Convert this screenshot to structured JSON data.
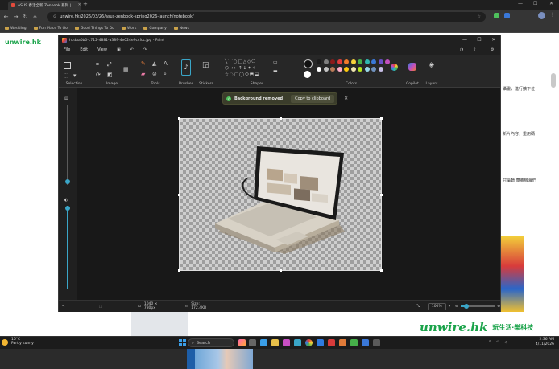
{
  "browser": {
    "tab_title": "ASUS 春活全新 Zenbook 系列 | ...",
    "url": "unwire.hk/2026/03/26/asus-zenbook-spring2026-launch/notebook/",
    "bookmarks": [
      "Wedding",
      "Fun Place To Go",
      "Good Things To Do",
      "Work",
      "Company",
      "News"
    ]
  },
  "site": {
    "logo_top": "unwire.hk",
    "side_texts": [
      "攝畫，進行擴下位",
      "新片內容，重用碼",
      "討論轉 華義機海們"
    ],
    "footer_logo": "unwire.hk",
    "footer_slogan": "玩生活‧樂科技"
  },
  "paint": {
    "window_title": "hcdaa0b0-c712-4881-a389-4e024e9ccfcc.jpg - Paint",
    "menu": [
      "File",
      "Edit",
      "View"
    ],
    "ribbon_groups": [
      "Selection",
      "Image",
      "Tools",
      "Brushes",
      "Stickers",
      "Shapes",
      "Colors",
      "Copilot",
      "Layers"
    ],
    "toast": {
      "message": "Background removed",
      "action": "Copy to clipboard"
    },
    "status": {
      "dimensions": "1040 × 780px",
      "size": "Size: 172.4KB",
      "zoom": "100%"
    },
    "colors": [
      "#1b1b1b",
      "#7f7f7f",
      "#8b1a1a",
      "#e03b3b",
      "#f27a2a",
      "#f6d13a",
      "#46b04a",
      "#2fb8b0",
      "#3a78d8",
      "#6a4fc8",
      "#c24fbf",
      "#ffffff",
      "#c3c3c3",
      "#b97a57",
      "#ffaec9",
      "#ffc90e",
      "#efe4b0",
      "#b5e61d",
      "#99d9ea",
      "#7092be",
      "#c8bfe7"
    ]
  },
  "taskbar": {
    "weather_temp": "16°C",
    "weather_desc": "Partly sunny",
    "search_placeholder": "Search",
    "time": "2:36 AM",
    "date": "4/11/2026"
  }
}
